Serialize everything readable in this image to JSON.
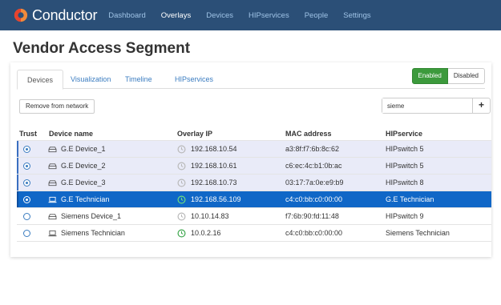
{
  "brand": {
    "name": "Conductor",
    "logo_colors": [
      "#e8432e",
      "#f08a3b"
    ]
  },
  "nav": {
    "items": [
      {
        "label": "Dashboard",
        "color": "#9fc3e6"
      },
      {
        "label": "Overlays",
        "color": "#ffffff"
      },
      {
        "label": "Devices",
        "color": "#9fc3e6"
      },
      {
        "label": "HIPservices",
        "color": "#9fc3e6"
      },
      {
        "label": "People",
        "color": "#9fc3e6"
      },
      {
        "label": "Settings",
        "color": "#9fc3e6"
      }
    ]
  },
  "page": {
    "title": "Vendor Access Segment"
  },
  "tabs": [
    {
      "label": "Devices",
      "active": true
    },
    {
      "label": "Visualization",
      "active": false
    },
    {
      "label": "Timeline",
      "active": false
    },
    {
      "label": "HIPservices",
      "active": false
    }
  ],
  "toggle": {
    "enabled_label": "Enabled",
    "disabled_label": "Disabled",
    "state": "enabled"
  },
  "toolbar": {
    "remove_label": "Remove from network",
    "search_value": "sieme",
    "add_label": "+"
  },
  "table": {
    "columns": [
      "Trust",
      "Device name",
      "Overlay IP",
      "MAC address",
      "HIPservice"
    ],
    "rows": [
      {
        "trust": true,
        "device_icon": "device-icon",
        "name": "G.E Device_1",
        "ip_status": "inactive",
        "ip": "192.168.10.54",
        "mac": "a3:8f:f7:6b:8c:62",
        "hipservice": "HIPswitch 5",
        "style": "member"
      },
      {
        "trust": true,
        "device_icon": "device-icon",
        "name": "G.E Device_2",
        "ip_status": "inactive",
        "ip": "192.168.10.61",
        "mac": "c6:ec:4c:b1:0b:ac",
        "hipservice": "HIPswitch 5",
        "style": "member"
      },
      {
        "trust": true,
        "device_icon": "device-icon",
        "name": "G.E Device_3",
        "ip_status": "inactive",
        "ip": "192.168.10.73",
        "mac": "03:17:7a:0e:e9:b9",
        "hipservice": "HIPswitch 8",
        "style": "member"
      },
      {
        "trust": true,
        "device_icon": "laptop-icon",
        "name": "G.E Technician",
        "ip_status": "active",
        "ip": "192.168.56.109",
        "mac": "c4:c0:bb:c0:00:00",
        "hipservice": "G.E Technician",
        "style": "selected"
      },
      {
        "trust": false,
        "device_icon": "device-icon",
        "name": "Siemens Device_1",
        "ip_status": "inactive",
        "ip": "10.10.14.83",
        "mac": "f7:6b:90:fd:11:48",
        "hipservice": "HIPswitch 9",
        "style": "normal"
      },
      {
        "trust": false,
        "device_icon": "laptop-icon",
        "name": "Siemens Technician",
        "ip_status": "active",
        "ip": "10.0.2.16",
        "mac": "c4:c0:bb:c0:00:00",
        "hipservice": "Siemens Technician",
        "style": "normal"
      }
    ]
  },
  "colors": {
    "navbar": "#2b4f77",
    "selected_row": "#1067c7",
    "member_row": "#e9ebf8",
    "enabled": "#3c9a3c",
    "status_active": "#3aa64a",
    "status_inactive": "#b8b8b8"
  }
}
